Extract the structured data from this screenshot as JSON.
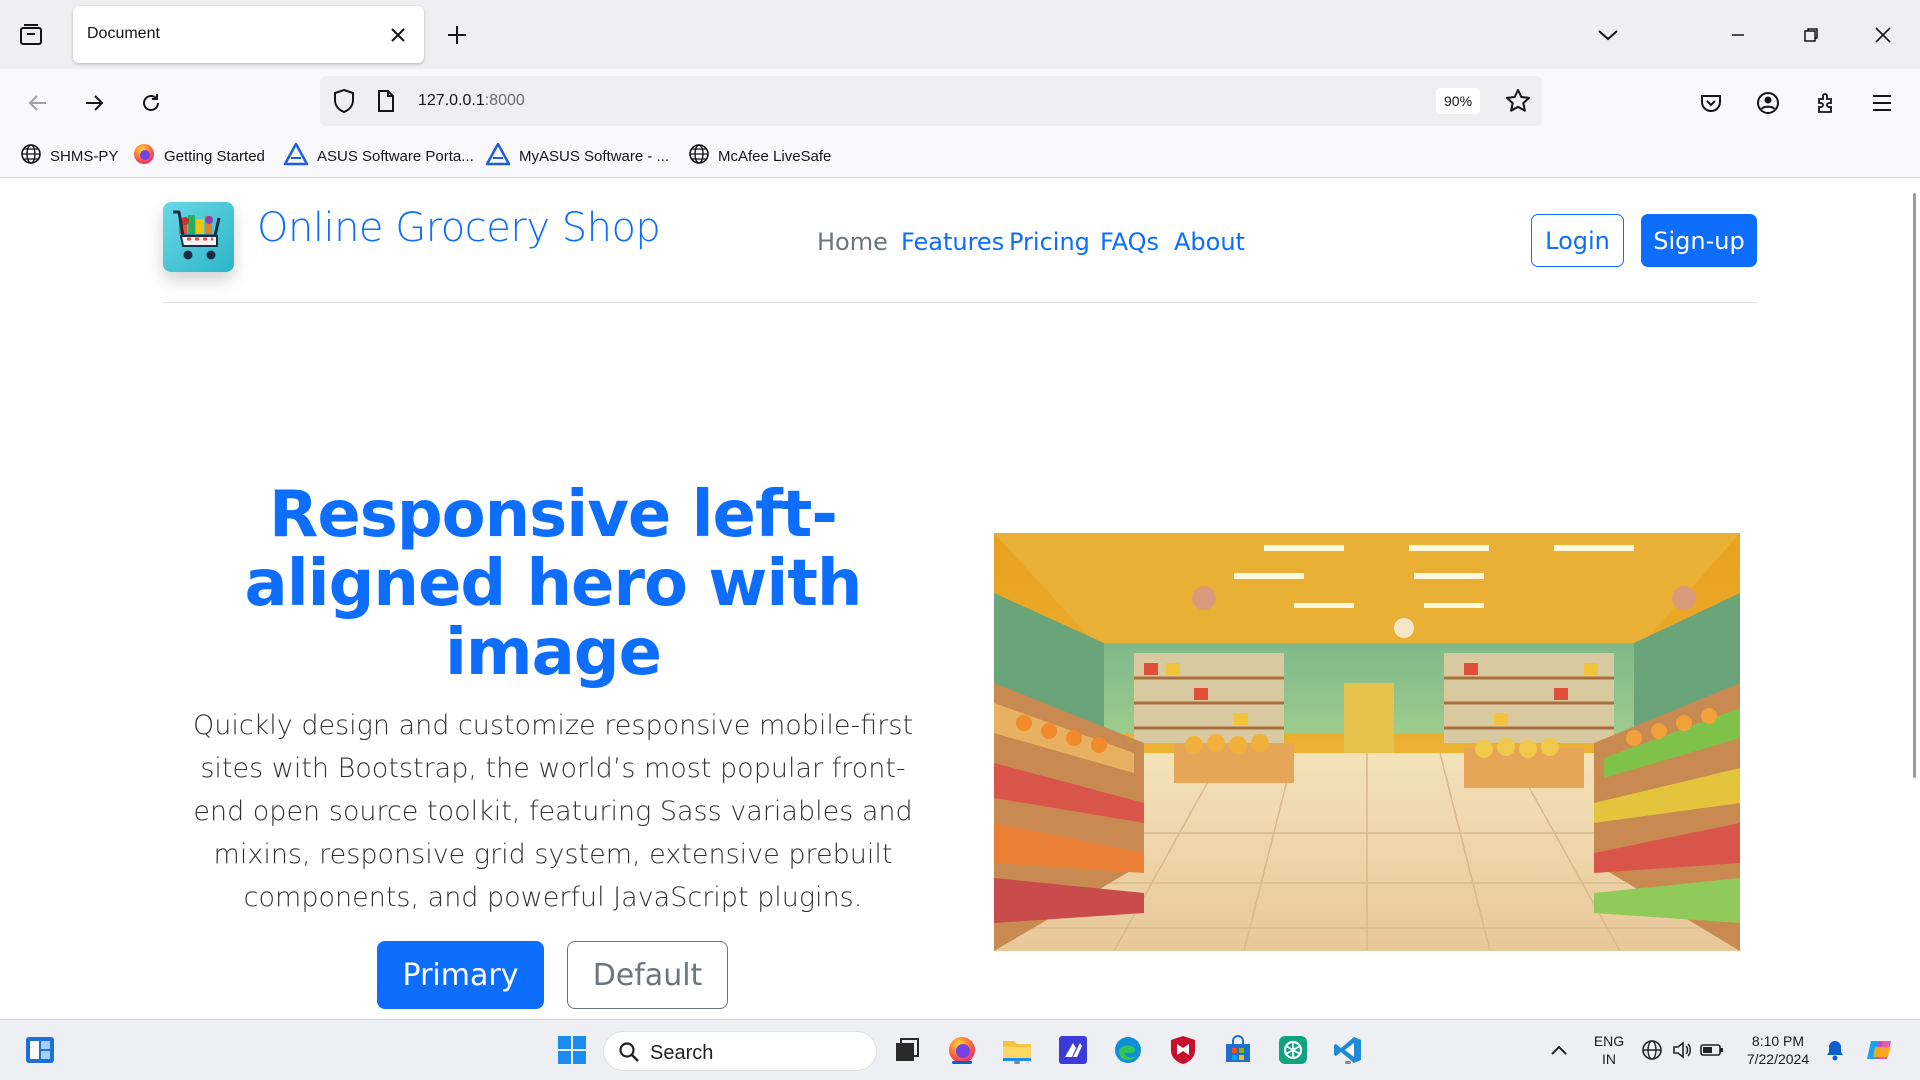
{
  "browser": {
    "tab_title": "Document",
    "url_host": "127.0.0.1",
    "url_port": ":8000",
    "zoom": "90%",
    "bookmarks": [
      {
        "label": "SHMS-PY",
        "icon": "globe-icon"
      },
      {
        "label": "Getting Started",
        "icon": "firefox-icon"
      },
      {
        "label": "ASUS Software Porta...",
        "icon": "asus-icon"
      },
      {
        "label": "MyASUS Software - ...",
        "icon": "asus-icon"
      },
      {
        "label": "McAfee LiveSafe",
        "icon": "globe-icon"
      }
    ]
  },
  "site": {
    "brand": "Online Grocery Shop",
    "nav": [
      "Home",
      "Features",
      "Pricing",
      "FAQs",
      "About"
    ],
    "login_label": "Login",
    "signup_label": "Sign-up"
  },
  "hero": {
    "title": "Responsive left-aligned hero with image",
    "lead": "Quickly design and customize responsive mobile-first sites with Bootstrap, the world’s most popular front-end open source toolkit, featuring Sass variables and mixins, responsive grid system, extensive prebuilt components, and powerful JavaScript plugins.",
    "primary_label": "Primary",
    "default_label": "Default"
  },
  "taskbar": {
    "search_label": "Search",
    "language_line1": "ENG",
    "language_line2": "IN",
    "time": "8:10 PM",
    "date": "7/22/2024"
  },
  "colors": {
    "primary": "#0d6efd",
    "secondary": "#6c757d",
    "chrome_bg": "#efeff2"
  }
}
